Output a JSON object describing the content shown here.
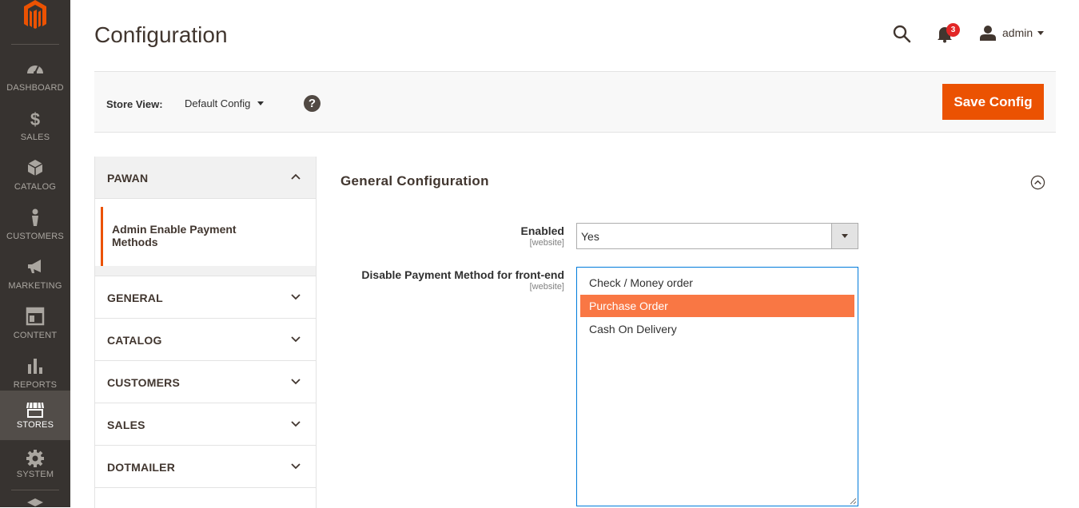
{
  "page": {
    "title": "Configuration"
  },
  "nav": {
    "items": [
      {
        "label": "DASHBOARD",
        "icon": "dashboard-icon"
      },
      {
        "label": "SALES",
        "icon": "dollar-icon"
      },
      {
        "label": "CATALOG",
        "icon": "box-icon"
      },
      {
        "label": "CUSTOMERS",
        "icon": "person-icon"
      },
      {
        "label": "MARKETING",
        "icon": "megaphone-icon"
      },
      {
        "label": "CONTENT",
        "icon": "layout-icon"
      },
      {
        "label": "REPORTS",
        "icon": "bar-chart-icon"
      },
      {
        "label": "STORES",
        "icon": "store-icon",
        "active": true
      },
      {
        "label": "SYSTEM",
        "icon": "gear-icon"
      }
    ]
  },
  "header": {
    "notifications_count": "3",
    "user_name": "admin"
  },
  "store_view": {
    "label": "Store View:",
    "value": "Default Config",
    "help": "?"
  },
  "actions": {
    "save_label": "Save Config"
  },
  "tabs": {
    "open_group": "PAWAN",
    "open_item": "Admin Enable Payment Methods",
    "groups": [
      "GENERAL",
      "CATALOG",
      "CUSTOMERS",
      "SALES",
      "DOTMAILER"
    ]
  },
  "section": {
    "title": "General Configuration",
    "fields": {
      "enabled": {
        "label": "Enabled",
        "scope": "[website]",
        "value": "Yes"
      },
      "disable_methods": {
        "label": "Disable Payment Method for front-end",
        "scope": "[website]",
        "options": [
          "Check / Money order",
          "Purchase Order",
          "Cash On Delivery"
        ],
        "selected": "Purchase Order"
      }
    }
  },
  "colors": {
    "accent": "#eb5202",
    "selected_option": "#f97744",
    "nav_bg": "#373330"
  }
}
